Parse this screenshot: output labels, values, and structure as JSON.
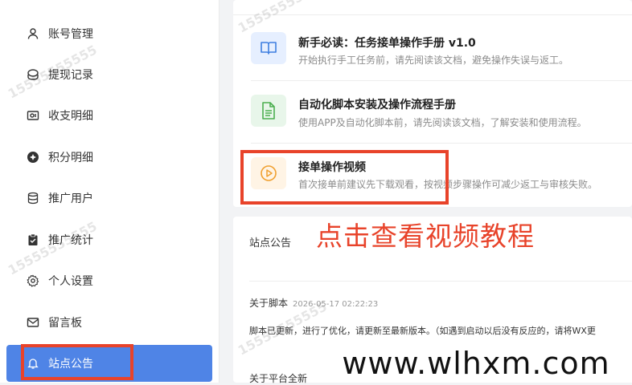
{
  "sidebar": {
    "items": [
      {
        "label": "账号管理",
        "icon": "user-icon"
      },
      {
        "label": "提现记录",
        "icon": "wallet-icon"
      },
      {
        "label": "收支明细",
        "icon": "bill-icon"
      },
      {
        "label": "积分明细",
        "icon": "points-icon"
      },
      {
        "label": "推广用户",
        "icon": "database-icon"
      },
      {
        "label": "推广统计",
        "icon": "clipboard-check-icon"
      },
      {
        "label": "个人设置",
        "icon": "gear-icon"
      },
      {
        "label": "留言板",
        "icon": "mail-icon"
      },
      {
        "label": "站点公告",
        "icon": "bell-icon",
        "active": true
      }
    ]
  },
  "manuals": [
    {
      "title": "新手必读：任务接单操作手册 v1.0",
      "desc": "开始执行手工任务前，请先阅读该文档，避免操作失误与返工。",
      "icon": "book-icon"
    },
    {
      "title": "自动化脚本安装及操作流程手册",
      "desc": "使用APP及自动化脚本前，请先阅读该文档，了解安装和使用流程。",
      "icon": "document-icon"
    },
    {
      "title": "接单操作视频",
      "desc": "首次接单前建议先下载观看，按视频步骤操作可减少返工与审核失败。",
      "icon": "play-icon"
    }
  ],
  "notice": {
    "title": "站点公告",
    "posts": [
      {
        "title": "关于脚本",
        "date": "2026-05-17 02:22:23",
        "body": "脚本已更新，进行了优化，请更新至最新版本。（如遇到启动以后没有反应的，请将WX更"
      },
      {
        "title": "关于平台全新",
        "date": "",
        "body": ""
      }
    ]
  },
  "annotation": "点击查看视频教程",
  "watermark": "15555555555",
  "brand": "www.wlhxm.com",
  "colors": {
    "accent": "#4f84e6",
    "highlight": "#e8432a"
  }
}
